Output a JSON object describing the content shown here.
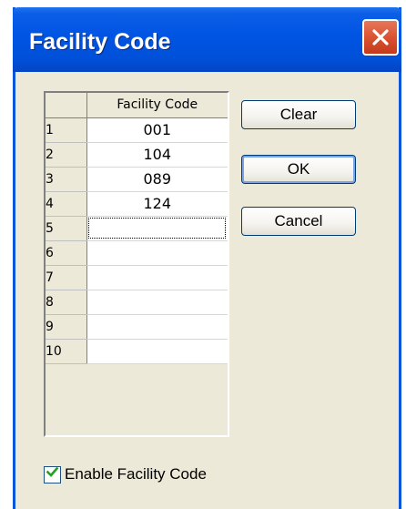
{
  "window": {
    "title": "Facility Code",
    "close_icon": "close-icon"
  },
  "grid": {
    "column_header": "Facility Code",
    "rows": [
      {
        "index": "1",
        "value": "001"
      },
      {
        "index": "2",
        "value": "104"
      },
      {
        "index": "3",
        "value": "089"
      },
      {
        "index": "4",
        "value": "124"
      },
      {
        "index": "5",
        "value": ""
      },
      {
        "index": "6",
        "value": ""
      },
      {
        "index": "7",
        "value": ""
      },
      {
        "index": "8",
        "value": ""
      },
      {
        "index": "9",
        "value": ""
      },
      {
        "index": "10",
        "value": ""
      }
    ],
    "focused_row": 5
  },
  "buttons": {
    "clear_label": "Clear",
    "ok_label": "OK",
    "cancel_label": "Cancel"
  },
  "options": {
    "enable_label": "Enable Facility Code",
    "enable_checked": true
  },
  "colors": {
    "titlebar": "#0054e3",
    "close_button": "#d8502f",
    "dialog_background": "#ece9d8",
    "checkmark": "#21a121"
  }
}
